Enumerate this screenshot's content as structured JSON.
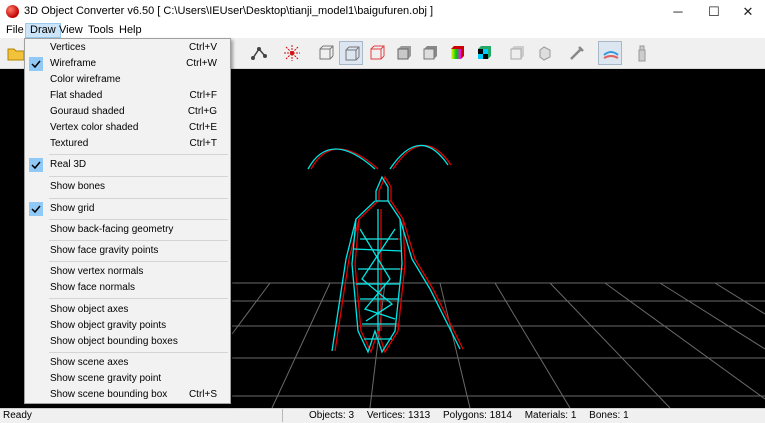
{
  "window": {
    "title": "3D Object Converter v6.50     [ C:\\Users\\IEUser\\Desktop\\tianji_model1\\baigufuren.obj ]",
    "minimize": "─",
    "maximize": "☐",
    "close": "✕"
  },
  "menubar": [
    "File",
    "Draw",
    "View",
    "Tools",
    "Help"
  ],
  "draw_menu": {
    "items": [
      {
        "label": "Vertices",
        "shortcut": "Ctrl+V",
        "checked": false
      },
      {
        "label": "Wireframe",
        "shortcut": "Ctrl+W",
        "checked": true
      },
      {
        "label": "Color wireframe",
        "shortcut": "",
        "checked": false
      },
      {
        "label": "Flat shaded",
        "shortcut": "Ctrl+F",
        "checked": false
      },
      {
        "label": "Gouraud shaded",
        "shortcut": "Ctrl+G",
        "checked": false
      },
      {
        "label": "Vertex color shaded",
        "shortcut": "Ctrl+E",
        "checked": false
      },
      {
        "label": "Textured",
        "shortcut": "Ctrl+T",
        "checked": false
      },
      {
        "label": "Real 3D",
        "shortcut": "",
        "checked": true
      },
      {
        "label": "Show bones",
        "shortcut": "",
        "checked": false
      },
      {
        "label": "Show grid",
        "shortcut": "",
        "checked": true
      },
      {
        "label": "Show back-facing geometry",
        "shortcut": "",
        "checked": false
      },
      {
        "label": "Show face gravity points",
        "shortcut": "",
        "checked": false
      },
      {
        "label": "Show vertex normals",
        "shortcut": "",
        "checked": false
      },
      {
        "label": "Show face normals",
        "shortcut": "",
        "checked": false
      },
      {
        "label": "Show object axes",
        "shortcut": "",
        "checked": false
      },
      {
        "label": "Show object gravity points",
        "shortcut": "",
        "checked": false
      },
      {
        "label": "Show object bounding boxes",
        "shortcut": "",
        "checked": false
      },
      {
        "label": "Show scene axes",
        "shortcut": "",
        "checked": false
      },
      {
        "label": "Show scene gravity point",
        "shortcut": "",
        "checked": false
      },
      {
        "label": "Show scene bounding box",
        "shortcut": "Ctrl+S",
        "checked": false
      }
    ]
  },
  "toolbar": {
    "icons": [
      "open-folder-icon",
      "bones-icon",
      "axes-icon",
      "wire-box-icon",
      "red-wire-box-icon",
      "gray-cube-icon",
      "shaded-cube-icon",
      "color-cube-icon",
      "textured-cube-icon",
      "light-cube-icon",
      "cube-faces-icon",
      "tool-icon",
      "grid-icon",
      "tower-icon"
    ]
  },
  "status": {
    "ready": "Ready",
    "objects": "Objects: 3",
    "vertices": "Vertices: 1313",
    "polygons": "Polygons: 1814",
    "materials": "Materials: 1",
    "bones": "Bones: 1"
  },
  "colors": {
    "wire_cyan": "#00e5e5",
    "wire_red": "#e00000",
    "menu_check": "#90c8f6",
    "menu_active": "#cce4f7"
  }
}
